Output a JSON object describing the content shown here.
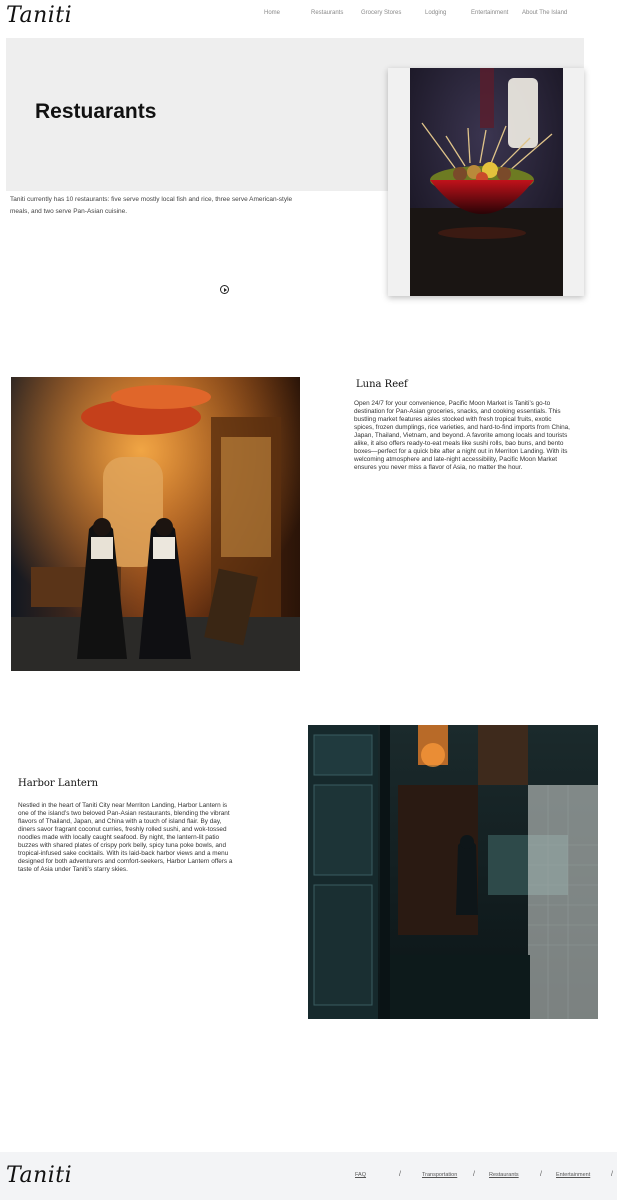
{
  "header": {
    "logo": "Taniti",
    "nav": [
      "Home",
      "Restaurants",
      "Grocery Stores",
      "Lodging",
      "Entertainment",
      "About The Island"
    ]
  },
  "hero": {
    "title": "Restuarants",
    "text": "Taniti currently has 10 restaurants: five serve mostly local fish and rice, three serve American-style meals, and two serve Pan-Asian cuisine."
  },
  "sections": [
    {
      "title": "Luna Reef",
      "text": "Open 24/7 for your convenience, Pacific Moon Market is Taniti’s go-to destination for Pan-Asian groceries, snacks, and cooking essentials. This bustling market features aisles stocked with fresh tropical fruits, exotic spices, frozen dumplings, rice varieties, and hard-to-find imports from China, Japan, Thailand, Vietnam, and beyond. A favorite among locals and tourists alike, it also offers ready-to-eat meals like sushi rolls, bao buns, and bento boxes—perfect for a quick bite after a night out in Merriton Landing. With its welcoming atmosphere and late-night accessibility, Pacific Moon Market ensures you never miss a flavor of Asia, no matter the hour."
    },
    {
      "title": "Harbor Lantern",
      "text": "Nestled in the heart of Taniti City near Merriton Landing, Harbor Lantern is one of the island’s two beloved Pan-Asian restaurants, blending the vibrant flavors of Thailand, Japan, and China with a touch of island flair. By day, diners savor fragrant coconut curries, freshly rolled sushi, and wok-tossed noodles made with locally caught seafood. By night, the lantern-lit patio buzzes with shared plates of crispy pork belly, spicy tuna poke bowls, and tropical-infused sake cocktails. With its laid-back harbor views and a menu designed for both adventurers and comfort-seekers, Harbor Lantern offers a taste of Asia under Taniti’s starry skies."
    }
  ],
  "footer": {
    "logo": "Taniti",
    "links": [
      "FAQ",
      "Transportation",
      "Restaurants",
      "Entertainment"
    ],
    "separator": "/"
  }
}
